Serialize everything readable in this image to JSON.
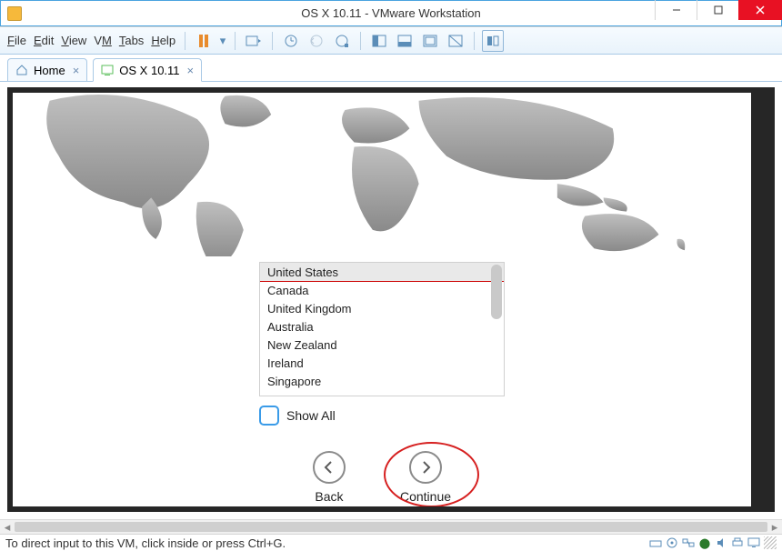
{
  "window": {
    "title": "OS X 10.11 - VMware Workstation"
  },
  "menu": {
    "file": "File",
    "edit": "Edit",
    "view": "View",
    "vm": "VM",
    "tabs": "Tabs",
    "help": "Help"
  },
  "tabs": {
    "home": "Home",
    "osx": "OS X 10.11"
  },
  "countries": [
    "United States",
    "Canada",
    "United Kingdom",
    "Australia",
    "New Zealand",
    "Ireland",
    "Singapore"
  ],
  "showall_label": "Show All",
  "nav": {
    "back": "Back",
    "continue": "Continue"
  },
  "statusbar": {
    "hint": "To direct input to this VM, click inside or press Ctrl+G."
  }
}
